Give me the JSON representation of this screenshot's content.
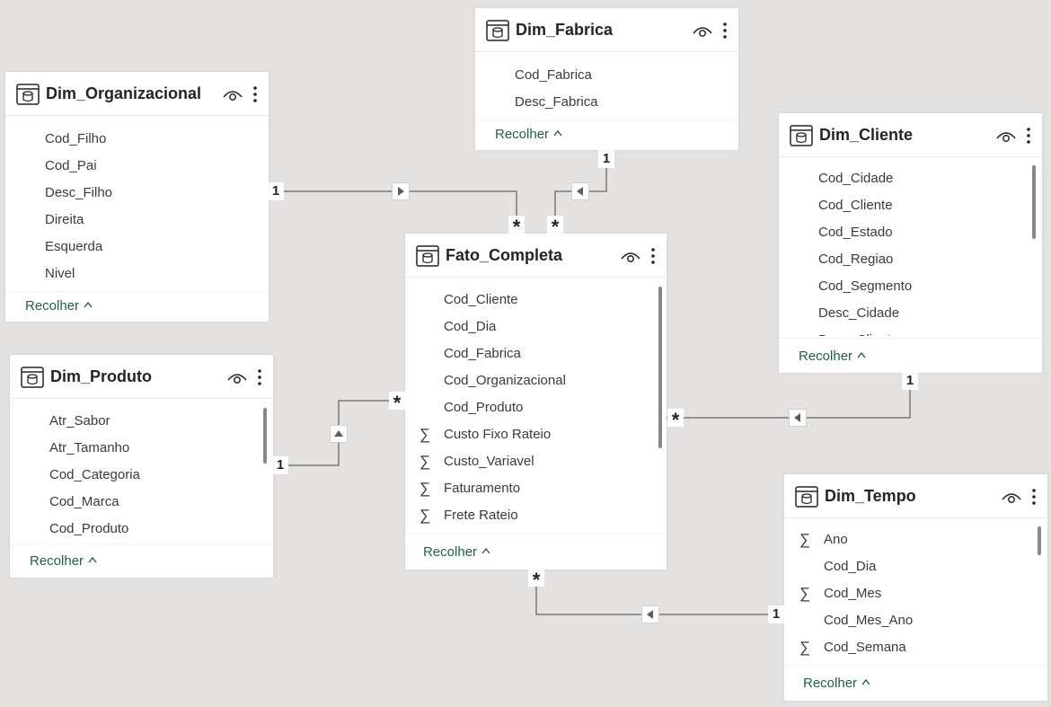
{
  "tables": {
    "dim_fabrica": {
      "title": "Dim_Fabrica",
      "fields": [
        {
          "name": "Cod_Fabrica",
          "sigma": false
        },
        {
          "name": "Desc_Fabrica",
          "sigma": false
        }
      ],
      "collapse_label": "Recolher"
    },
    "dim_organizacional": {
      "title": "Dim_Organizacional",
      "fields": [
        {
          "name": "Cod_Filho",
          "sigma": false
        },
        {
          "name": "Cod_Pai",
          "sigma": false
        },
        {
          "name": "Desc_Filho",
          "sigma": false
        },
        {
          "name": "Direita",
          "sigma": false
        },
        {
          "name": "Esquerda",
          "sigma": false
        },
        {
          "name": "Nivel",
          "sigma": false
        }
      ],
      "collapse_label": "Recolher"
    },
    "dim_cliente": {
      "title": "Dim_Cliente",
      "fields": [
        {
          "name": "Cod_Cidade",
          "sigma": false
        },
        {
          "name": "Cod_Cliente",
          "sigma": false
        },
        {
          "name": "Cod_Estado",
          "sigma": false
        },
        {
          "name": "Cod_Regiao",
          "sigma": false
        },
        {
          "name": "Cod_Segmento",
          "sigma": false
        },
        {
          "name": "Desc_Cidade",
          "sigma": false
        },
        {
          "name": "Desc_Cliente",
          "sigma": false
        }
      ],
      "collapse_label": "Recolher"
    },
    "fato_completa": {
      "title": "Fato_Completa",
      "fields": [
        {
          "name": "Cod_Cliente",
          "sigma": false
        },
        {
          "name": "Cod_Dia",
          "sigma": false
        },
        {
          "name": "Cod_Fabrica",
          "sigma": false
        },
        {
          "name": "Cod_Organizacional",
          "sigma": false
        },
        {
          "name": "Cod_Produto",
          "sigma": false
        },
        {
          "name": "Custo Fixo Rateio",
          "sigma": true
        },
        {
          "name": "Custo_Variavel",
          "sigma": true
        },
        {
          "name": "Faturamento",
          "sigma": true
        },
        {
          "name": "Frete Rateio",
          "sigma": true
        }
      ],
      "collapse_label": "Recolher"
    },
    "dim_produto": {
      "title": "Dim_Produto",
      "fields": [
        {
          "name": "Atr_Sabor",
          "sigma": false
        },
        {
          "name": "Atr_Tamanho",
          "sigma": false
        },
        {
          "name": "Cod_Categoria",
          "sigma": false
        },
        {
          "name": "Cod_Marca",
          "sigma": false
        },
        {
          "name": "Cod_Produto",
          "sigma": false
        }
      ],
      "collapse_label": "Recolher"
    },
    "dim_tempo": {
      "title": "Dim_Tempo",
      "fields": [
        {
          "name": "Ano",
          "sigma": true
        },
        {
          "name": "Cod_Dia",
          "sigma": false
        },
        {
          "name": "Cod_Mes",
          "sigma": true
        },
        {
          "name": "Cod_Mes_Ano",
          "sigma": false
        },
        {
          "name": "Cod_Semana",
          "sigma": true
        }
      ],
      "collapse_label": "Recolher"
    }
  },
  "relationships": {
    "one_label": "1",
    "many_label": "*"
  },
  "icons": {
    "table": "table-icon",
    "visibility": "eye-icon",
    "menu": "more-options-icon",
    "collapse": "chevron-up-icon",
    "sum": "sigma-icon",
    "filter_direction": "triangle-arrow-icon"
  },
  "colors": {
    "canvas": "#e3e2e0",
    "card": "#ffffff",
    "accent": "#1f5f4e",
    "line": "#7a7876"
  }
}
